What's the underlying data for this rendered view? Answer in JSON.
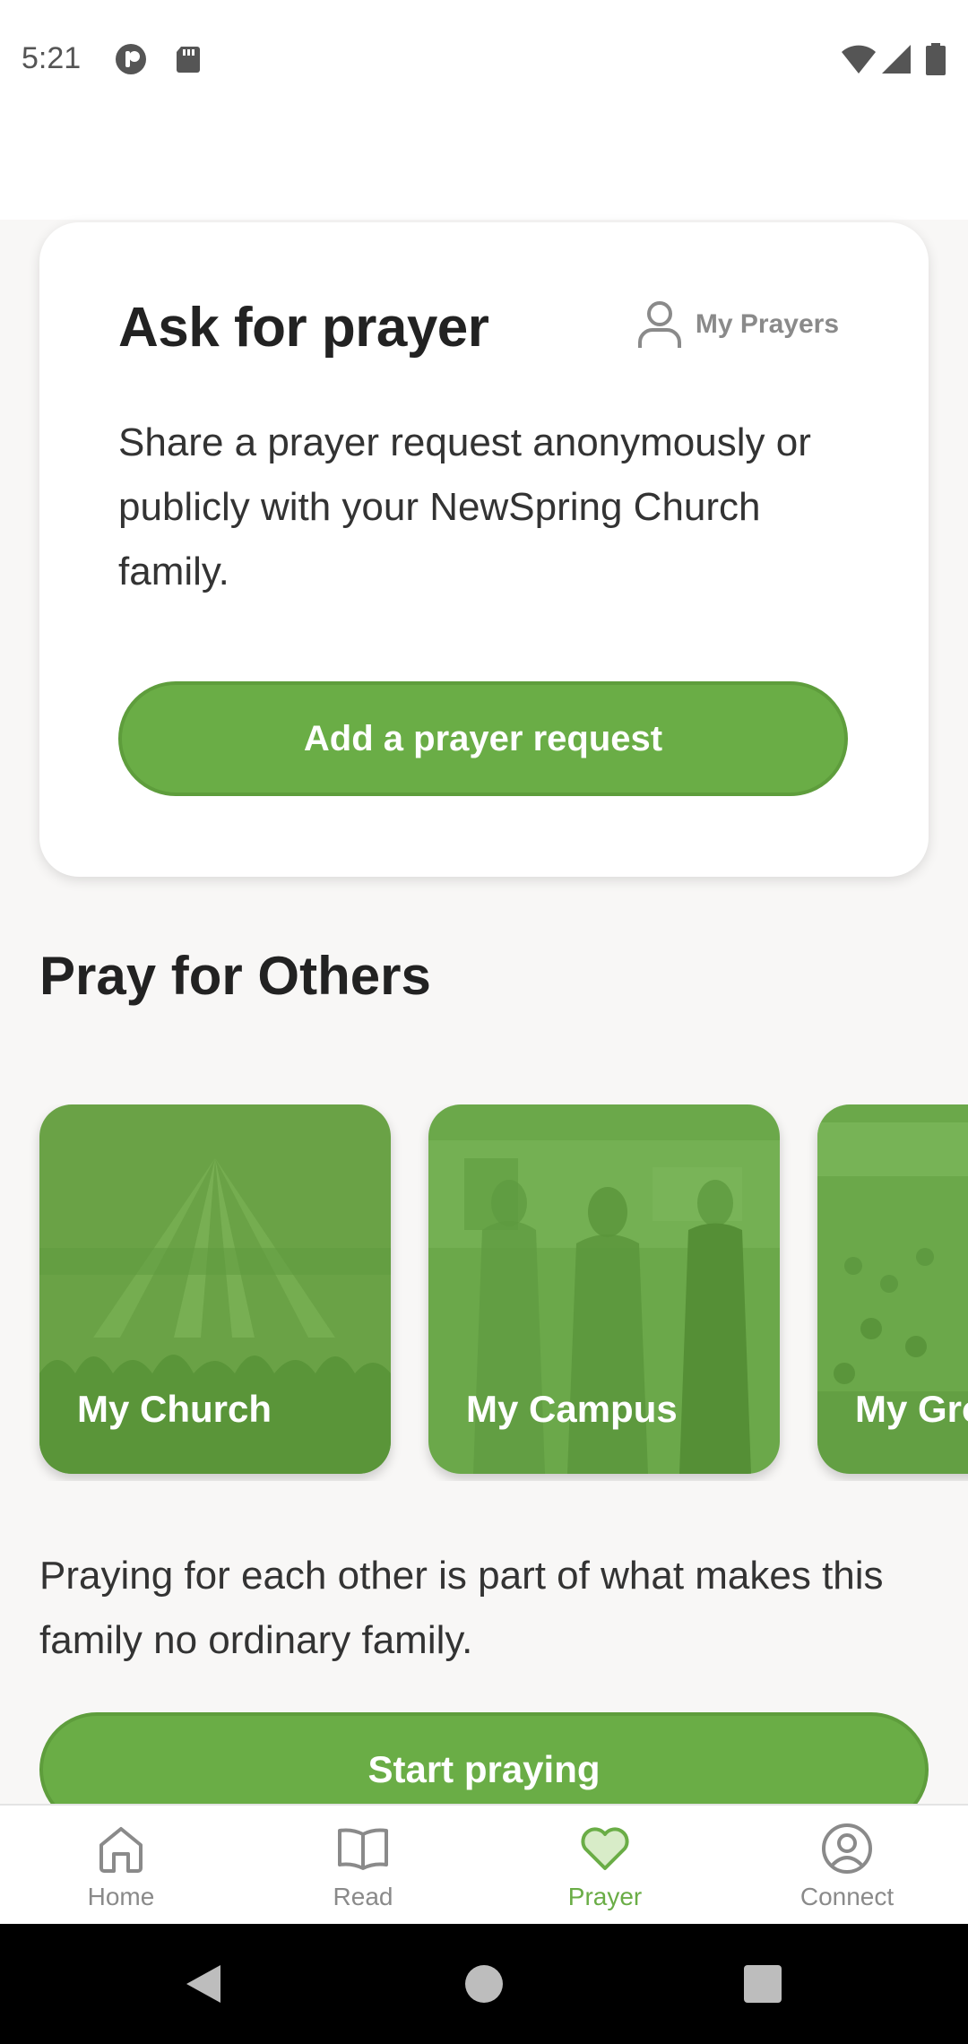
{
  "status_bar": {
    "time": "5:21"
  },
  "ask_card": {
    "title": "Ask for prayer",
    "my_prayers_label": "My Prayers",
    "description": "Share a prayer request anonymously or publicly with your NewSpring Church family.",
    "add_button_label": "Add a prayer request"
  },
  "pray_for_others": {
    "title": "Pray for Others",
    "tiles": [
      {
        "label": "My Church"
      },
      {
        "label": "My Campus"
      },
      {
        "label": "My Groups"
      }
    ]
  },
  "footer": {
    "text": "Praying for each other is part of what makes this family no ordinary family.",
    "start_button_label": "Start praying"
  },
  "tab_bar": {
    "tabs": [
      {
        "label": "Home",
        "icon": "home-icon"
      },
      {
        "label": "Read",
        "icon": "book-icon"
      },
      {
        "label": "Prayer",
        "icon": "heart-icon",
        "active": true
      },
      {
        "label": "Connect",
        "icon": "user-circle-icon"
      }
    ]
  },
  "colors": {
    "accent": "#6aad46",
    "inactive": "#8a8a8a",
    "text": "#222222"
  }
}
